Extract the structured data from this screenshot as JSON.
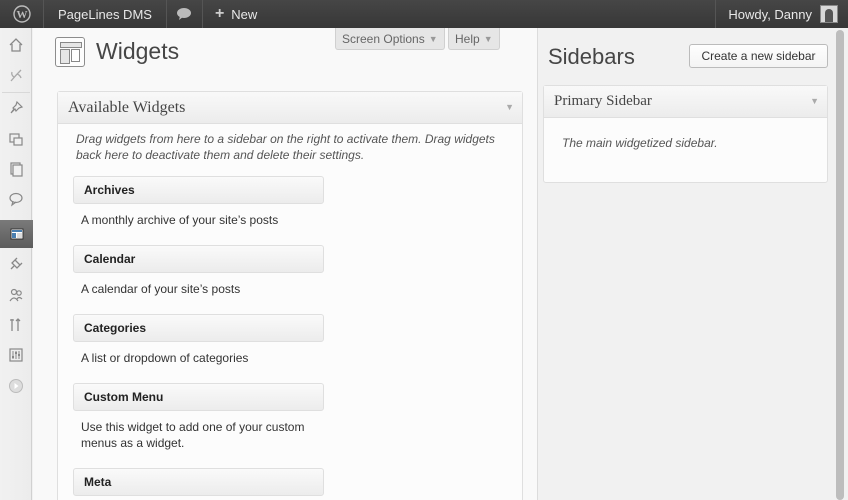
{
  "admin_bar": {
    "wp_icon": "wordpress-logo-icon",
    "site_name": "PageLines DMS",
    "comments_icon": "comment-bubble-icon",
    "new_plus": "+",
    "new_label": "New",
    "greeting": "Howdy, Danny"
  },
  "menu_icons": [
    "dashboard-icon",
    "pagelines-icon",
    "posts-pin-icon",
    "media-icon",
    "pages-icon",
    "comments-icon",
    "appearance-icon",
    "plugins-icon",
    "users-icon",
    "tools-icon",
    "settings-icon",
    "collapse-icon"
  ],
  "screen_meta": {
    "screen_options": "Screen Options",
    "help": "Help"
  },
  "page": {
    "title": "Widgets"
  },
  "available": {
    "title": "Available Widgets",
    "description": "Drag widgets from here to a sidebar on the right to activate them. Drag widgets back here to deactivate them and delete their settings.",
    "widgets": [
      {
        "name": "Archives",
        "desc": "A monthly archive of your site’s posts"
      },
      {
        "name": "Calendar",
        "desc": "A calendar of your site’s posts"
      },
      {
        "name": "Categories",
        "desc": "A list or dropdown of categories"
      },
      {
        "name": "Custom Menu",
        "desc": "Use this widget to add one of your custom menus as a widget."
      },
      {
        "name": "Meta",
        "desc": ""
      }
    ]
  },
  "sidebars": {
    "title": "Sidebars",
    "create_button": "Create a new sidebar",
    "primary": {
      "title": "Primary Sidebar",
      "description": "The main widgetized sidebar."
    }
  },
  "colors": {
    "admin_bar": "#464646",
    "current_menu": "#6d6d6d"
  }
}
